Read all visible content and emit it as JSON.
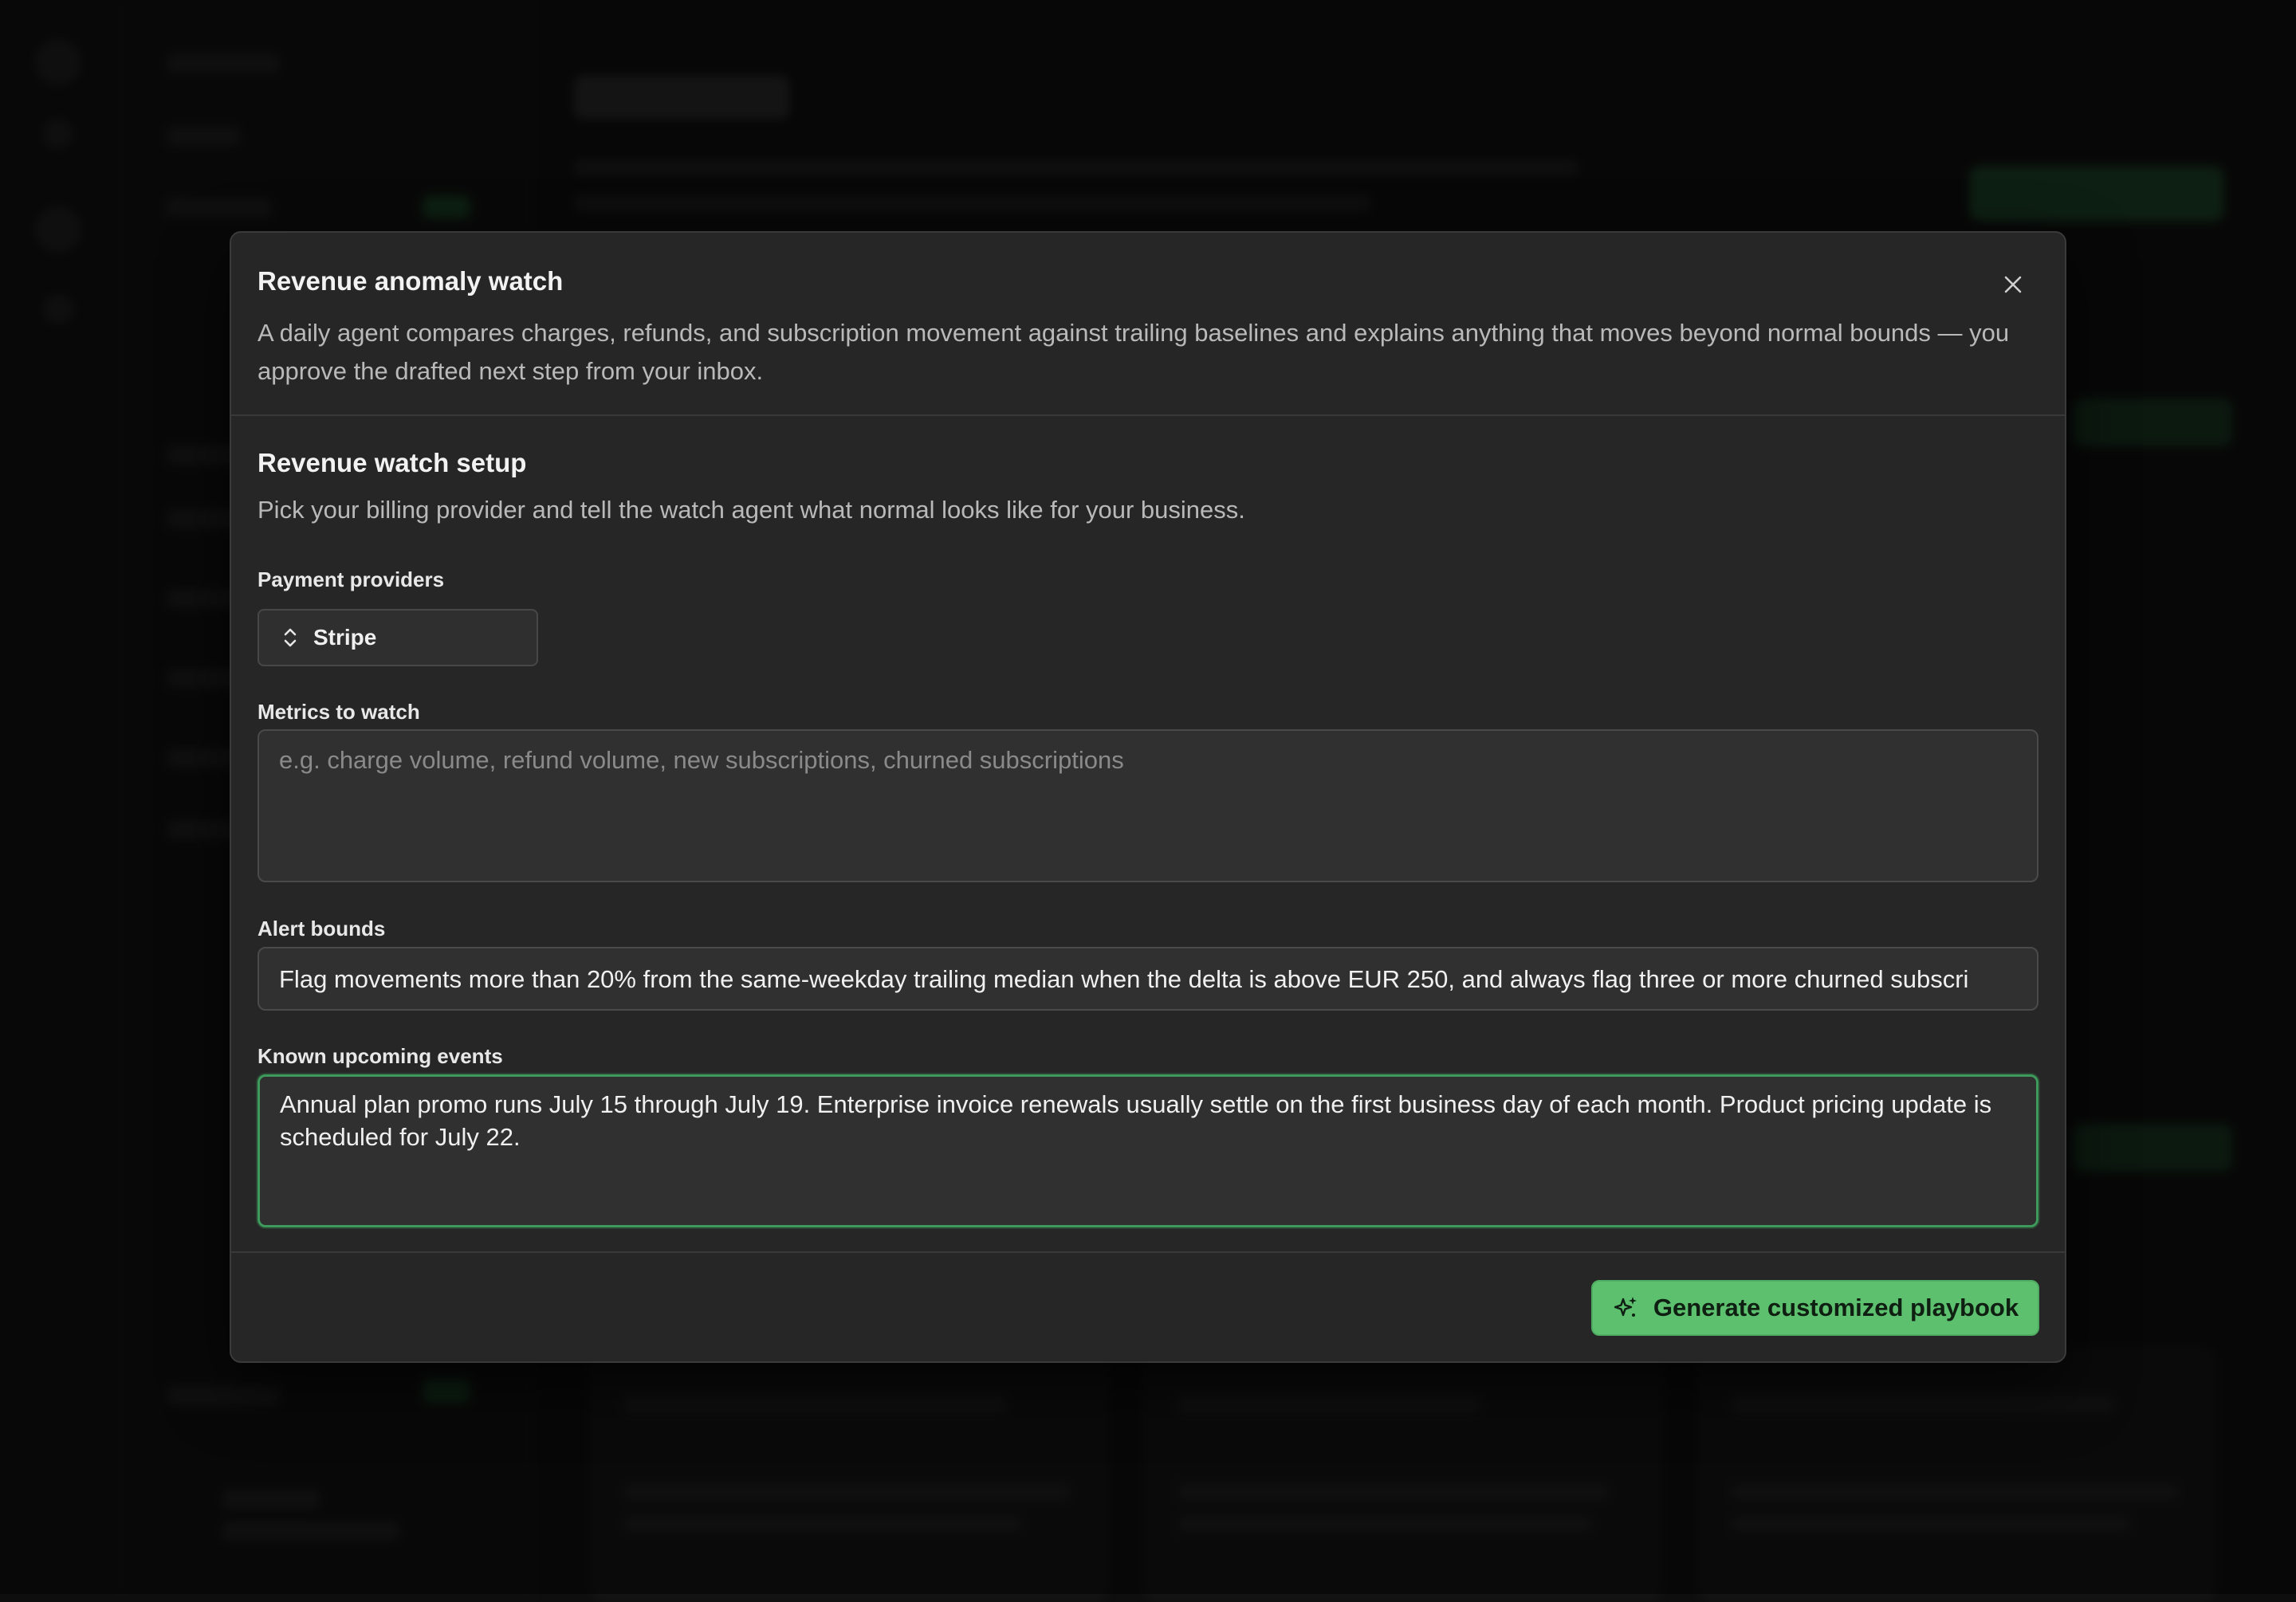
{
  "modal": {
    "title": "Revenue anomaly watch",
    "description": "A daily agent compares charges, refunds, and subscription movement against trailing baselines and explains anything that moves beyond normal bounds — you approve the drafted next step from your inbox."
  },
  "setup": {
    "title": "Revenue watch setup",
    "subtitle": "Pick your billing provider and tell the watch agent what normal looks like for your business."
  },
  "form": {
    "payment_providers": {
      "label": "Payment providers",
      "selected": "Stripe"
    },
    "metrics": {
      "label": "Metrics to watch",
      "value": "",
      "placeholder": "e.g. charge volume, refund volume, new subscriptions, churned subscriptions"
    },
    "alert_bounds": {
      "label": "Alert bounds",
      "value": "Flag movements more than 20% from the same-weekday trailing median when the delta is above EUR 250, and always flag three or more churned subscri"
    },
    "events": {
      "label": "Known upcoming events",
      "value": "Annual plan promo runs July 15 through July 19. Enterprise invoice renewals usually settle on the first business day of each month. Product pricing update is scheduled for July 22."
    }
  },
  "footer": {
    "generate_label": "Generate customized playbook"
  },
  "colors": {
    "accent": "#5cc06f",
    "focus_border": "#3d9a5a",
    "modal_bg": "#262626"
  },
  "icons": {
    "close": "close-icon",
    "select": "chevron-up-down-icon",
    "generate": "sparkle-icon"
  }
}
